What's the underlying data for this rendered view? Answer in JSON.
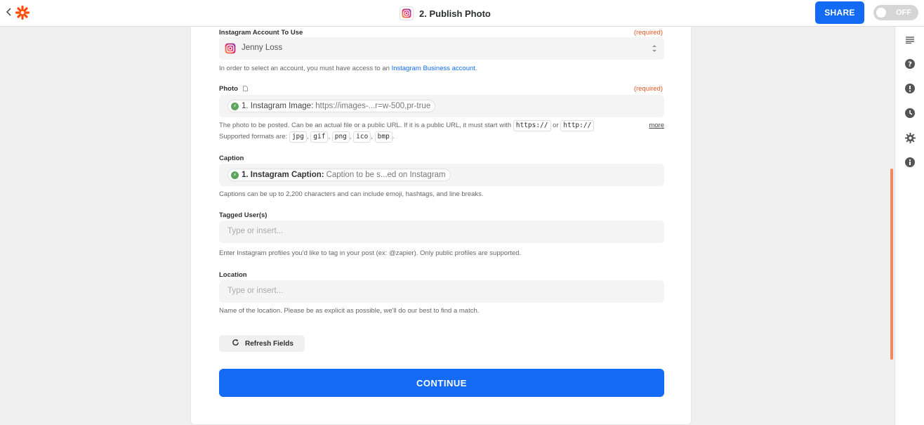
{
  "header": {
    "title": "2. Publish Photo",
    "share_label": "SHARE",
    "toggle_label": "OFF"
  },
  "account": {
    "label": "Instagram Account To Use",
    "required": "(required)",
    "value": "Jenny Loss",
    "help_prefix": "In order to select an account, you must have access to an ",
    "help_link": "Instagram Business account."
  },
  "photo": {
    "label": "Photo",
    "required": "(required)",
    "pill_key": "1. Instagram Image:",
    "pill_value": "https://images-...r=w-500,pr-true",
    "help_line1": "The photo to be posted. Can be an actual file or a public URL. If it is a public URL, it must start with",
    "code_https": "https://",
    "or": "or",
    "code_http": "http://",
    "more": "more",
    "formats_prefix": "Supported formats are:",
    "formats": [
      "jpg",
      "gif",
      "png",
      "ico",
      "bmp"
    ]
  },
  "caption": {
    "label": "Caption",
    "pill_key": "1. Instagram Caption:",
    "pill_value": "Caption to be s...ed on Instagram",
    "help": "Captions can be up to 2,200 characters and can include emoji, hashtags, and line breaks."
  },
  "tagged": {
    "label": "Tagged User(s)",
    "placeholder": "Type or insert...",
    "help": "Enter Instagram profiles you'd like to tag in your post (ex: @zapier). Only public profiles are supported."
  },
  "location": {
    "label": "Location",
    "placeholder": "Type or insert...",
    "help": "Name of the location. Please be as explicit as possible, we'll do our best to find a match."
  },
  "refresh_label": "Refresh Fields",
  "continue_label": "CONTINUE",
  "colors": {
    "accent": "#136bf5",
    "brand": "#ff4a00",
    "required": "#e5571f"
  },
  "sidebar_icons": [
    "details-icon",
    "help-icon",
    "alert-icon",
    "history-icon",
    "settings-icon",
    "info-icon"
  ]
}
